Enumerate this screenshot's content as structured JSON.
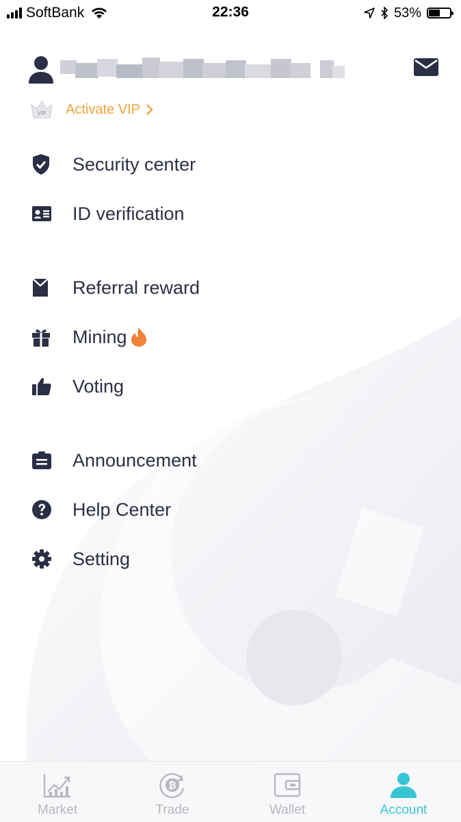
{
  "status_bar": {
    "carrier": "SoftBank",
    "time": "22:36",
    "battery_percent": "53%",
    "battery_level": 0.53
  },
  "header": {
    "vip_label": "Activate VIP",
    "vip_badge_text": "VIP"
  },
  "menu": {
    "items": [
      {
        "label": "Security center",
        "icon": "shield-check-icon"
      },
      {
        "label": "ID verification",
        "icon": "id-card-icon"
      },
      {
        "label": "Referral reward",
        "icon": "envelope-icon"
      },
      {
        "label": "Mining",
        "icon": "gift-icon",
        "badge_icon": "fire-icon"
      },
      {
        "label": "Voting",
        "icon": "thumbs-up-icon"
      },
      {
        "label": "Announcement",
        "icon": "clipboard-icon"
      },
      {
        "label": "Help Center",
        "icon": "question-circle-icon"
      },
      {
        "label": "Setting",
        "icon": "gear-icon"
      }
    ]
  },
  "tabbar": {
    "tabs": [
      {
        "label": "Market",
        "icon": "chart-icon",
        "active": false
      },
      {
        "label": "Trade",
        "icon": "bitcoin-icon",
        "active": false
      },
      {
        "label": "Wallet",
        "icon": "wallet-icon",
        "active": false
      },
      {
        "label": "Account",
        "icon": "user-icon",
        "active": true
      }
    ]
  },
  "colors": {
    "accent": "#37c5d6",
    "vip": "#f2a33a",
    "text": "#2b2f45",
    "fire": "#f0823a"
  }
}
